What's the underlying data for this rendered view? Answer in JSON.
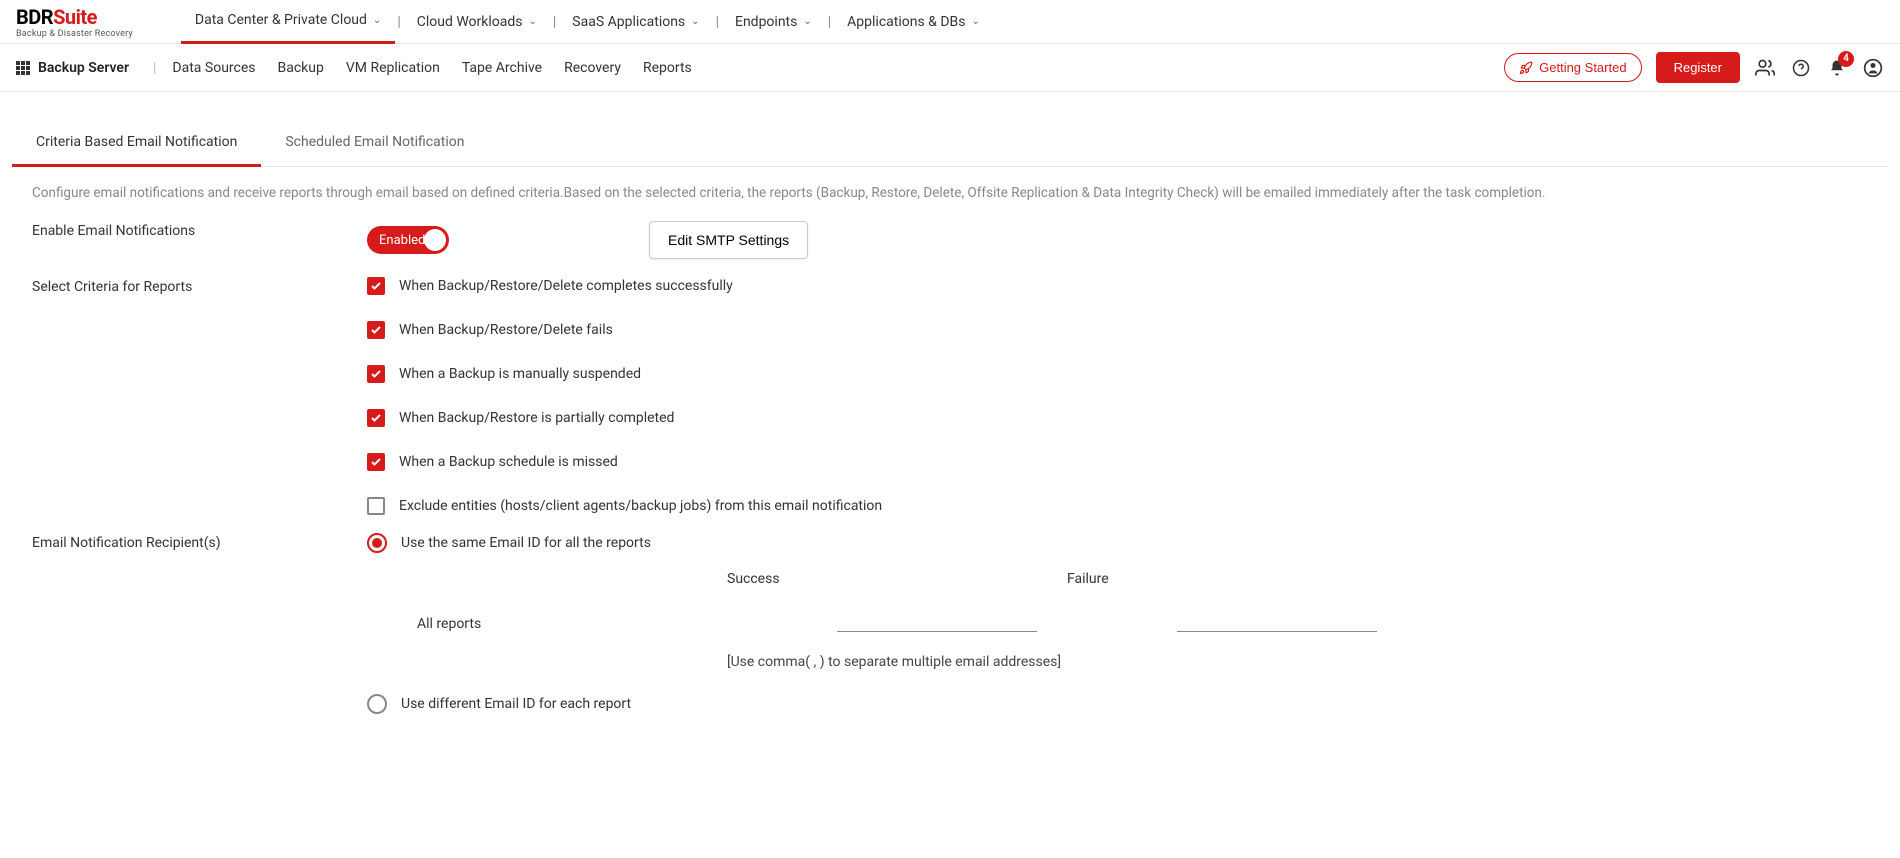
{
  "logo": {
    "bdr": "BDR",
    "suite": "Suite",
    "sub": "Backup & Disaster Recovery"
  },
  "topMenu": [
    {
      "label": "Data Center & Private Cloud",
      "active": true
    },
    {
      "label": "Cloud Workloads"
    },
    {
      "label": "SaaS Applications"
    },
    {
      "label": "Endpoints"
    },
    {
      "label": "Applications & DBs"
    }
  ],
  "secondNav": {
    "title": "Backup Server",
    "items": [
      "Data Sources",
      "Backup",
      "VM Replication",
      "Tape Archive",
      "Recovery",
      "Reports"
    ]
  },
  "actions": {
    "gettingStarted": "Getting Started",
    "register": "Register",
    "badge": "4"
  },
  "tabs": [
    {
      "label": "Criteria Based Email Notification",
      "active": true
    },
    {
      "label": "Scheduled Email Notification"
    }
  ],
  "description": "Configure email notifications and receive reports through email based on defined criteria.Based on the selected criteria, the reports (Backup, Restore, Delete, Offsite Replication & Data Integrity Check) will be emailed immediately after the task completion.",
  "labels": {
    "enable": "Enable Email Notifications",
    "criteria": "Select Criteria for Reports",
    "recipients": "Email Notification Recipient(s)",
    "toggleEnabled": "Enabled",
    "editSmtp": "Edit SMTP Settings",
    "successHeader": "Success",
    "failureHeader": "Failure",
    "allReports": "All reports",
    "emailHint": "[Use comma( , ) to separate multiple email addresses]"
  },
  "criteria": [
    {
      "label": "When Backup/Restore/Delete completes successfully",
      "checked": true
    },
    {
      "label": "When Backup/Restore/Delete fails",
      "checked": true
    },
    {
      "label": "When a Backup is manually suspended",
      "checked": true
    },
    {
      "label": "When Backup/Restore is partially completed",
      "checked": true
    },
    {
      "label": "When a Backup schedule is missed",
      "checked": true
    },
    {
      "label": "Exclude entities (hosts/client agents/backup jobs) from this email notification",
      "checked": false
    }
  ],
  "recipientOptions": [
    {
      "label": "Use the same Email ID for all the reports",
      "selected": true
    },
    {
      "label": "Use different Email ID for each report",
      "selected": false
    }
  ],
  "emails": {
    "success": "",
    "failure": ""
  }
}
